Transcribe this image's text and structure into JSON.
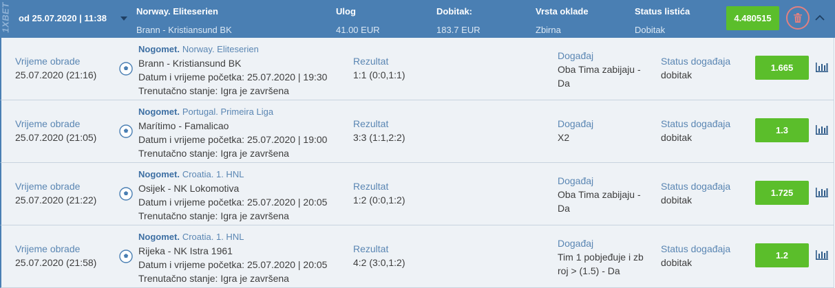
{
  "brand": "1XBET",
  "header": {
    "date": "od 25.07.2020 | 11:38",
    "championship_label": "Norway. Eliteserien",
    "match": "Brann - Kristiansund BK",
    "stake_label": "Ulog",
    "stake_value": "41.00 EUR",
    "winnings_label": "Dobitak:",
    "winnings_value": "183.7 EUR",
    "bet_type_label": "Vrsta oklade",
    "bet_type_value": "Zbirna",
    "status_label": "Status listića",
    "status_value": "Dobitak",
    "total_coef": "4.480515"
  },
  "colors": {
    "header_bg": "#4a7fb3",
    "row_bg": "#eef2f6",
    "accent_green": "#5bbe2b",
    "delete_red": "#e28080"
  },
  "icons": [
    "trash-icon",
    "chevron-up-icon",
    "soccer-ball-icon",
    "bar-chart-icon",
    "dropdown-caret-icon"
  ],
  "events": [
    {
      "processing_label": "Vrijeme obrade",
      "processing_time": "25.07.2020 (21:16)",
      "sport": "Nogomet.",
      "championship": "Norway. Eliteserien",
      "match": "Brann - Kristiansund BK",
      "start": "Datum i vrijeme početka: 25.07.2020 | 19:30",
      "state": "Trenutačno stanje: Igra je završena",
      "result_label": "Rezultat",
      "result": "1:1 (0:0,1:1)",
      "event_label": "Događaj",
      "event_line1": "Oba Tima zabijaju -",
      "event_line2": "Da",
      "status_label": "Status događaja",
      "status": "dobitak",
      "odd": "1.665"
    },
    {
      "processing_label": "Vrijeme obrade",
      "processing_time": "25.07.2020 (21:05)",
      "sport": "Nogomet.",
      "championship": "Portugal. Primeira Liga",
      "match": "Marítimo - Famalicao",
      "start": "Datum i vrijeme početka: 25.07.2020 | 19:00",
      "state": "Trenutačno stanje: Igra je završena",
      "result_label": "Rezultat",
      "result": "3:3 (1:1,2:2)",
      "event_label": "Događaj",
      "event_line1": "X2",
      "event_line2": "",
      "status_label": "Status događaja",
      "status": "dobitak",
      "odd": "1.3"
    },
    {
      "processing_label": "Vrijeme obrade",
      "processing_time": "25.07.2020 (21:22)",
      "sport": "Nogomet.",
      "championship": "Croatia. 1. HNL",
      "match": "Osijek - NK Lokomotiva",
      "start": "Datum i vrijeme početka: 25.07.2020 | 20:05",
      "state": "Trenutačno stanje: Igra je završena",
      "result_label": "Rezultat",
      "result": "1:2 (0:0,1:2)",
      "event_label": "Događaj",
      "event_line1": "Oba Tima zabijaju -",
      "event_line2": "Da",
      "status_label": "Status događaja",
      "status": "dobitak",
      "odd": "1.725"
    },
    {
      "processing_label": "Vrijeme obrade",
      "processing_time": "25.07.2020 (21:58)",
      "sport": "Nogomet.",
      "championship": "Croatia. 1. HNL",
      "match": "Rijeka - NK Istra 1961",
      "start": "Datum i vrijeme početka: 25.07.2020 | 20:05",
      "state": "Trenutačno stanje: Igra je završena",
      "result_label": "Rezultat",
      "result": "4:2 (3:0,1:2)",
      "event_label": "Događaj",
      "event_line1": "Tim 1 pobjeđuje i zb",
      "event_line2": "roj > (1.5) - Da",
      "status_label": "Status događaja",
      "status": "dobitak",
      "odd": "1.2"
    }
  ]
}
